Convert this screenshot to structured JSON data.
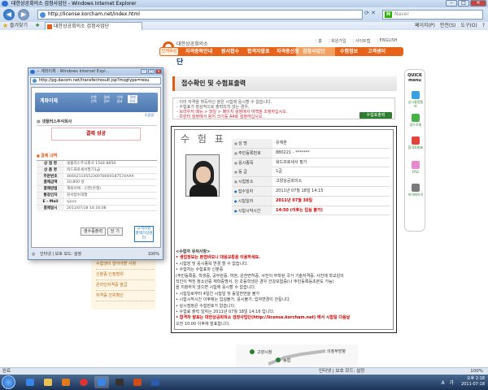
{
  "browser": {
    "title": "대한상공회의소 검정사업단 - Windows Internet Explorer",
    "url": "http://license.korcham.net/index.html",
    "search_placeholder": "Naver",
    "search_logo": "N",
    "favorites_label": "즐겨찾기",
    "tab_title": "대한상공회의소 검정사업단",
    "tools": [
      "페이지(P)",
      "안전(S)",
      "도구(O)"
    ],
    "status_left": "완료",
    "status_zone": "인터넷 | 보호 모드: 설정",
    "zoom": "100%"
  },
  "site": {
    "logo_top": "대한상공회의소",
    "logo_main": "검정사업단",
    "util_links": [
      "홈",
      "회원가입",
      "사이트맵",
      "ENGLISH"
    ],
    "gnb_home": "인재육성",
    "gnb_items": [
      "자격종목안내",
      "원서접수",
      "합격자발표",
      "자격증신청",
      "검정사업단",
      "수험정보",
      "고객센터"
    ],
    "left_links": [
      "수험생이 알아야할 사항",
      "신분증 인정범위",
      "온라인자격증 발급",
      "자격증 진위확인"
    ],
    "quick": {
      "title": "QUICK menu",
      "items": [
        "상시평정통보",
        "접수조회",
        "합격자발표",
        "FAQ",
        "마이페이지"
      ]
    },
    "page_title": "접수확인 및 수험표출력",
    "notice": [
      "- 이미 자격을 취득하신 분은 시험에 응시할 수 없습니다.",
      "- 수험표가 정상적으로 출력되지 않는 경우,",
      "  - 브라우저 메뉴 > 파일 > 페이지 설정에서 여백을 조정하십시오.",
      "  - 프린터 설정에서 용지 크기를 A4로 설정하십시오."
    ],
    "print_button": "수험표출력"
  },
  "ticket": {
    "title": "수 험 표",
    "rows": [
      {
        "key": "성 명",
        "value": "유재훈",
        "style": "normal"
      },
      {
        "key": "주민등록번호",
        "value": "880221 - *******",
        "style": "normal"
      },
      {
        "key": "응시종목",
        "value": "워드프로세서 필기",
        "style": "normal"
      },
      {
        "key": "등 급",
        "value": "1급",
        "style": "normal"
      },
      {
        "key": "시험장소",
        "value": "고양상공회의소",
        "style": "normal"
      },
      {
        "key": "접수일자",
        "value": "2011년 07월 18일 14:15",
        "style": "blue"
      },
      {
        "key": "시험일자",
        "value": "2011년 07월 30일",
        "style": "blue-red"
      },
      {
        "key": "시험시작시간",
        "value": "14:50 (이후는 입실 불가)",
        "style": "blue-red"
      }
    ],
    "caution_title": "<수험자 유의사항>",
    "cautions": [
      "• 생업정보는 본점바오니 대응교통을 이용하세요.",
      "• 시험장 및 응시종목 변경 할 수 없습니다.",
      "• 수험자는 수험표와 신분증",
      "  (주민등록증, 학생증, 공무원증, 여권, 운전면허증, 사진이 부착된 국가 기술자격증, 사진에 학교감의",
      "  직인이 찍힌 청소년증 재학증명서, 단 초등학생은 경우 건강보험증(나 주민등록등초본도 가능)",
      "  을 지참하지 않으면 시험에 응시할 수 없습니다.",
      "• 시험일로부터 4일간 시험일 및 동일한번을 불가",
      "• 시험시작시간 이후에는 입실불가, 응시불가, 입자변경이 안됩니다.",
      "• 상시점정은 수험번호가 없습니다.",
      "• 수험료 출력 일자는 2011년 07월 18일 14:16 입니다.",
      "• 합격자 발표는 대한상공회의소 검정사업단(http://license.korcham.net) 에서 시험일 다음날",
      "  오전 10:00 이후에 발표합니다."
    ],
    "map_labels": [
      "고양시청",
      "농협",
      "의정부방향"
    ]
  },
  "popup": {
    "title": "-- 계좌이체 - Windows Internet Expl...",
    "url": "http://pg.dacom.net/transfer/result.jsp?msgtype=resu",
    "logo": "계좌이체",
    "steps": [
      "은행 선택",
      "결제 정보",
      "이체 결과",
      "결제 완료"
    ],
    "note": "도움말",
    "company": "넷플러스주식회사",
    "result": "결제 성공",
    "section": "결제 내역",
    "rows": [
      {
        "key": "상 점 명",
        "value": "넷플러스주식회사 1544-8850"
      },
      {
        "key": "상 품 명",
        "value": "워드프로세서필기1급"
      },
      {
        "key": "주문번호",
        "value": "4660211055230078000187574AAA"
      },
      {
        "key": "결제금액",
        "value": "10,800 원"
      },
      {
        "key": "결제방법",
        "value": "계좌이체 - 신한(은행)"
      },
      {
        "key": "통장인자",
        "value": "원서접수대행"
      },
      {
        "key": "E - Mail",
        "value": "sjxxx"
      },
      {
        "key": "결제일시",
        "value": "2011/07/18 14:16:08"
      }
    ],
    "buttons": [
      "영수증출력",
      "닫 기"
    ],
    "customer_center": "고객지원 결제가상원터",
    "status_left": "인터넷 | 보호 모드: 설정",
    "zoom": "100%"
  },
  "taskbar": {
    "time": "오후 2:18",
    "date": "2011-07-18",
    "tray_lang": "A 가"
  }
}
